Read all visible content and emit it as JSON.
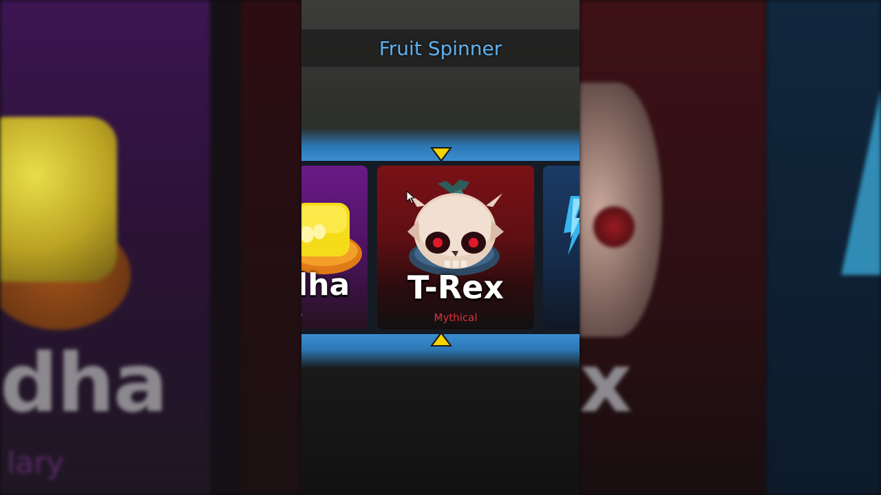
{
  "spinner": {
    "title": "Fruit Spinner"
  },
  "cards": {
    "left": {
      "name": "dha",
      "rarity": "ary",
      "rarity_color": "#a845c9",
      "card_color": "#5a167a"
    },
    "center": {
      "name": "T-Rex",
      "rarity": "Mythical",
      "rarity_color": "#e0323c",
      "card_color": "#6e1015"
    },
    "right": {
      "card_color": "#1a3b66"
    }
  },
  "background": {
    "left_big_text": "dha",
    "left_small_text": "lary",
    "right_big_text": "x"
  },
  "colors": {
    "title": "#5fb0f0",
    "pointer": "#f5d400",
    "glow": "#3b8ed0"
  },
  "icons": {
    "pointer_top": "down-triangle",
    "pointer_bottom": "up-triangle",
    "cursor": "mouse-pointer"
  }
}
